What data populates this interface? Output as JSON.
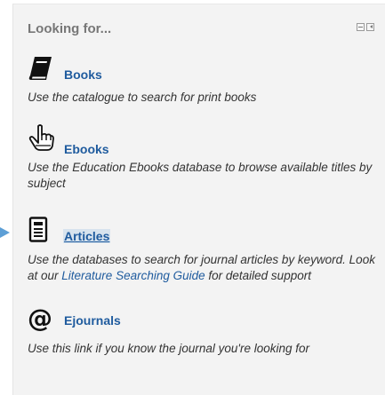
{
  "block": {
    "title": "Looking for...",
    "controls": [
      "hide-block",
      "dock-block"
    ]
  },
  "items": [
    {
      "icon": "book-icon",
      "label": "Books",
      "description": "Use the catalogue to search for print books"
    },
    {
      "icon": "hand-pointer-icon",
      "label": "Ebooks",
      "description": "Use the Education Ebooks database to browse available titles by subject"
    },
    {
      "icon": "newspaper-icon",
      "label": "Articles",
      "description_before": "Use the databases to search for journal articles by keyword. Look at our ",
      "description_link": "Literature Searching Guide",
      "description_after": " for detailed support"
    },
    {
      "icon": "at-sign-icon",
      "label": "Ejournals",
      "description": "Use this link if you know the journal you're looking for"
    }
  ],
  "colors": {
    "panel_background": "#f3f3f3",
    "link": "#1f5b9e",
    "title": "#777777",
    "arrow": "#5d9fd6"
  }
}
